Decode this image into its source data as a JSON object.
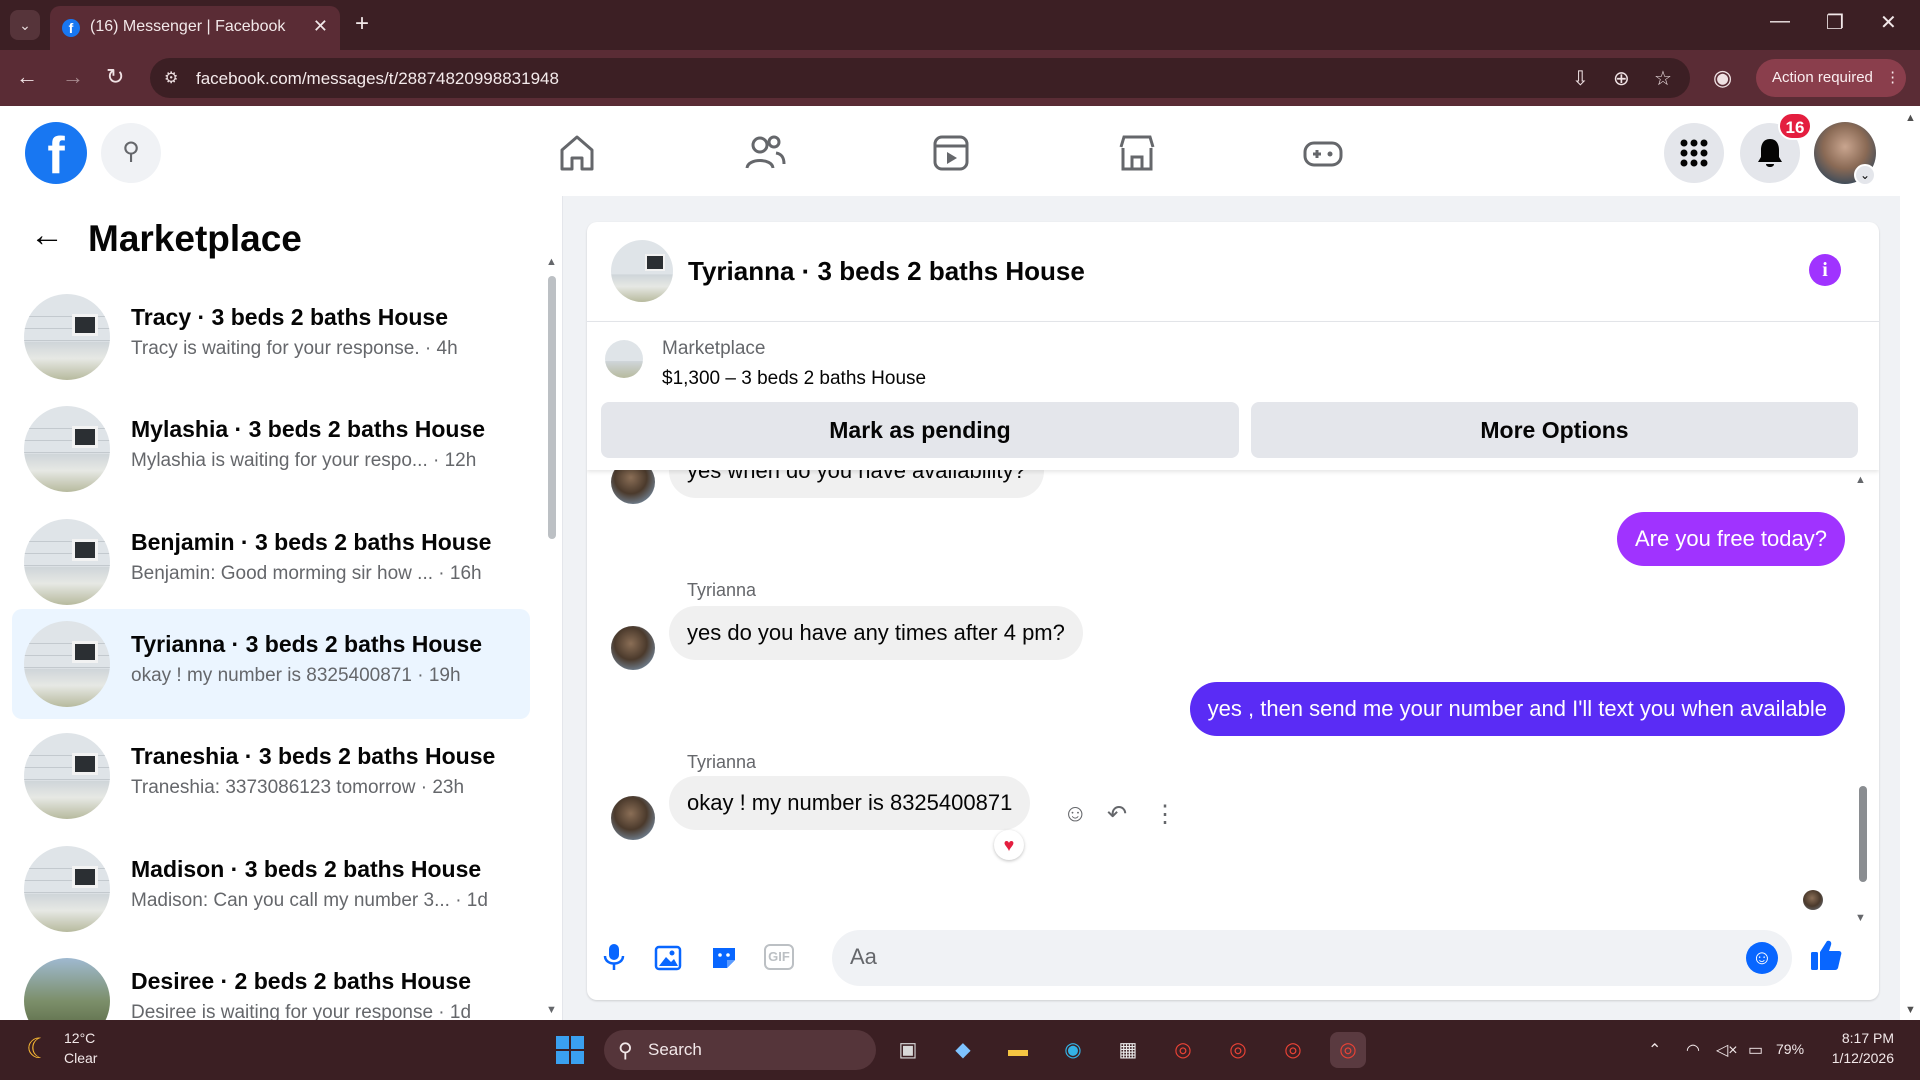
{
  "browser": {
    "tab_title": "(16) Messenger | Facebook",
    "url": "facebook.com/messages/t/28874820998831948",
    "action_required": "Action required"
  },
  "fb": {
    "notification_count": "16"
  },
  "sidebar": {
    "title": "Marketplace",
    "conversations": [
      {
        "name": "Tracy · 3 beds 2 baths House",
        "preview": "Tracy is waiting for your response. · 4h"
      },
      {
        "name": "Mylashia · 3 beds 2 baths House",
        "preview": "Mylashia is waiting for your respo... · 12h"
      },
      {
        "name": "Benjamin · 3 beds 2 baths House",
        "preview": "Benjamin: Good morming sir how ... · 16h"
      },
      {
        "name": "Tyrianna · 3 beds 2 baths House",
        "preview": "okay ! my number is 8325400871 · 19h"
      },
      {
        "name": "Traneshia · 3 beds 2 baths House",
        "preview": "Traneshia: 3373086123 tomorrow · 23h"
      },
      {
        "name": "Madison · 3 beds 2 baths House",
        "preview": "Madison: Can you call my number 3... · 1d"
      },
      {
        "name": "Desiree · 2 beds 2 baths House",
        "preview": "Desiree is waiting for your response · 1d"
      }
    ]
  },
  "chat": {
    "title": "Tyrianna · 3 beds 2 baths House",
    "listing_label": "Marketplace",
    "listing_price": "$1,300 – 3 beds 2 baths House",
    "mark_pending": "Mark as pending",
    "more_options": "More Options",
    "messages": {
      "m0": "yes when do you have availability?",
      "m1": "Are you free today?",
      "sender1": "Tyrianna",
      "m2": "yes do you have any times after 4 pm?",
      "m3": "yes , then send me your number and I'll text you when available",
      "sender2": "Tyrianna",
      "m4": "okay ! my number is 8325400871"
    },
    "composer_placeholder": "Aa"
  },
  "taskbar": {
    "temp": "12°C",
    "condition": "Clear",
    "search": "Search",
    "battery": "79%",
    "time": "8:17 PM",
    "date": "1/12/2026"
  }
}
